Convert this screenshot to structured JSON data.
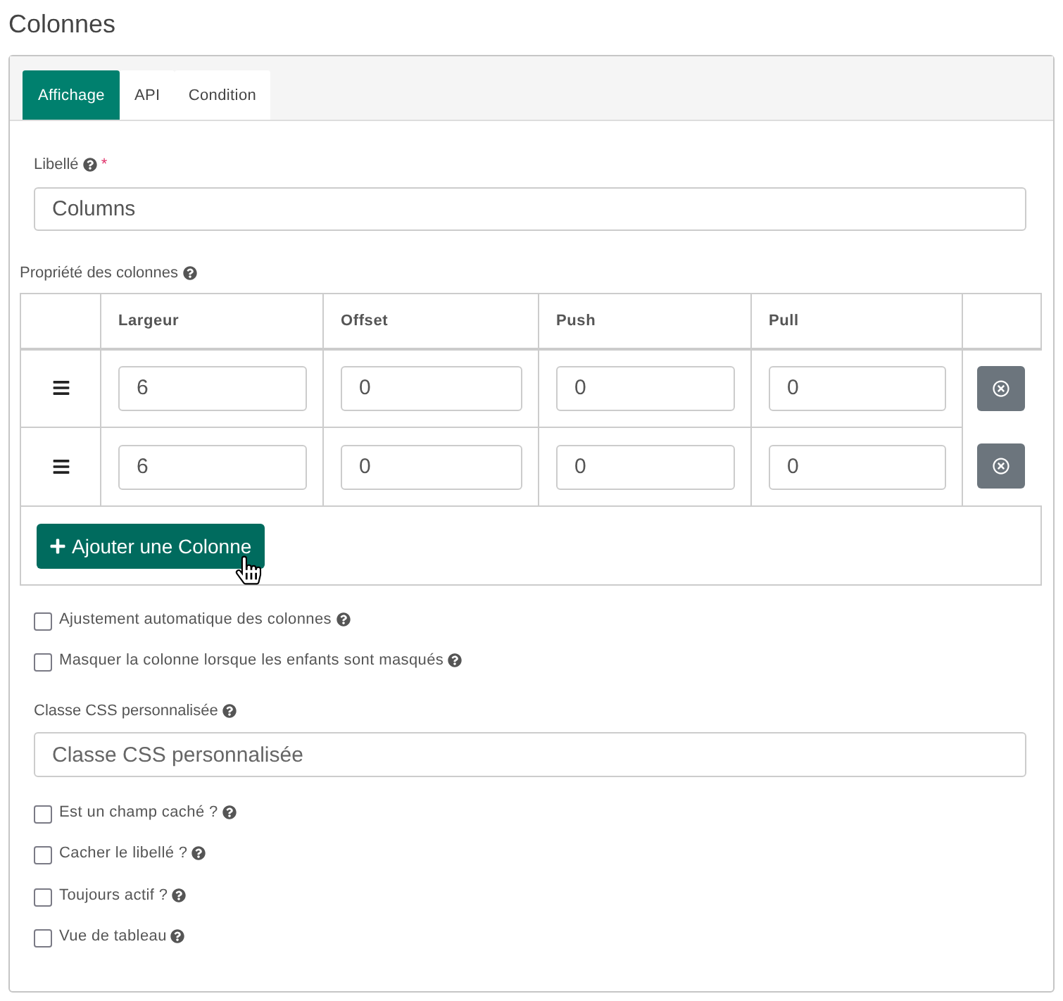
{
  "title": "Colonnes",
  "tabs": [
    {
      "label": "Affichage",
      "selected": true
    },
    {
      "label": "API",
      "selected": false
    },
    {
      "label": "Condition",
      "selected": false
    }
  ],
  "label_field": {
    "label": "Libellé",
    "required_mark": "*",
    "value": "Columns"
  },
  "column_properties": {
    "label": "Propriété des colonnes",
    "columns": [
      "Largeur",
      "Offset",
      "Push",
      "Pull"
    ],
    "rows": [
      {
        "values": [
          "6",
          "0",
          "0",
          "0"
        ]
      },
      {
        "values": [
          "6",
          "0",
          "0",
          "0"
        ]
      }
    ],
    "add_button": "Ajouter une Colonne"
  },
  "layout_options": [
    {
      "label": "Ajustement automatique des colonnes",
      "checked": false
    },
    {
      "label": "Masquer la colonne lorsque les enfants sont masqués",
      "checked": false
    }
  ],
  "css_class_field": {
    "label": "Classe CSS personnalisée",
    "placeholder": "Classe CSS personnalisée"
  },
  "field_options": [
    {
      "label": "Est un champ caché ?",
      "checked": false
    },
    {
      "label": "Cacher le libellé ?",
      "checked": false
    },
    {
      "label": "Toujours actif ?",
      "checked": false
    },
    {
      "label": "Vue de tableau",
      "checked": false
    }
  ]
}
